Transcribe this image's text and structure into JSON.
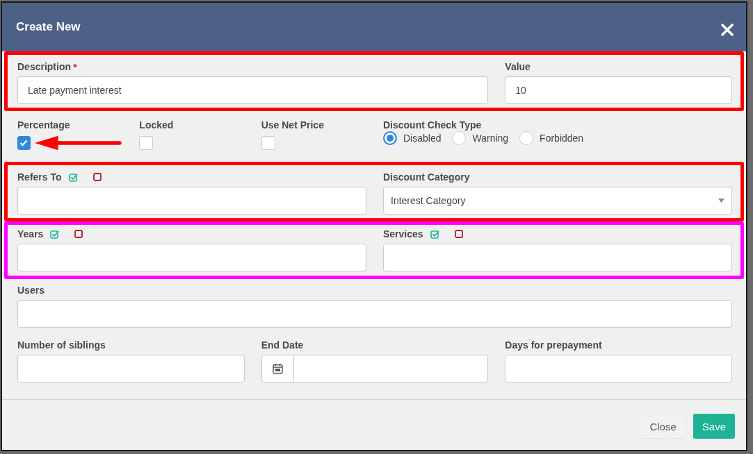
{
  "window": {
    "title": "Create New"
  },
  "rows": [
    {
      "color": "#ff0000",
      "items": [
        {
          "kind": "text",
          "label": "Description",
          "required_mark": "*",
          "value": "Late payment interest"
        },
        {
          "kind": "text",
          "label": "Value",
          "value": "10"
        }
      ]
    },
    {
      "items": [
        {
          "kind": "checkbox",
          "label": "Percentage",
          "checked": true,
          "pointer_arrow": true
        },
        {
          "kind": "checkbox",
          "label": "Locked",
          "checked": false
        },
        {
          "kind": "checkbox",
          "label": "Use Net Price",
          "checked": false
        },
        {
          "kind": "radio",
          "label": "Discount Check Type",
          "options": [
            {
              "label": "Disabled",
              "selected": true
            },
            {
              "label": "Warning",
              "selected": false
            },
            {
              "label": "Forbidden",
              "selected": false
            }
          ]
        }
      ]
    },
    {
      "color": "#ff0000",
      "items": [
        {
          "kind": "text",
          "label": "Refers To",
          "filter_icons": true
        },
        {
          "kind": "select",
          "label": "Discount Category",
          "value": "Interest Category"
        }
      ]
    },
    {
      "color": "#ff00ff",
      "items": [
        {
          "kind": "text",
          "label": "Years",
          "filter_icons": true
        },
        {
          "kind": "text",
          "label": "Services",
          "filter_icons": true
        }
      ]
    },
    {
      "items": [
        {
          "kind": "text",
          "label": "Users"
        }
      ]
    },
    {
      "items": [
        {
          "kind": "text",
          "label": "Number of siblings"
        },
        {
          "kind": "date",
          "label": "End Date"
        },
        {
          "kind": "text",
          "label": "Days for prepayment"
        }
      ]
    }
  ],
  "buttons": [
    {
      "kind": "secondary",
      "label": "Close"
    },
    {
      "kind": "primary",
      "label": "Save"
    }
  ]
}
